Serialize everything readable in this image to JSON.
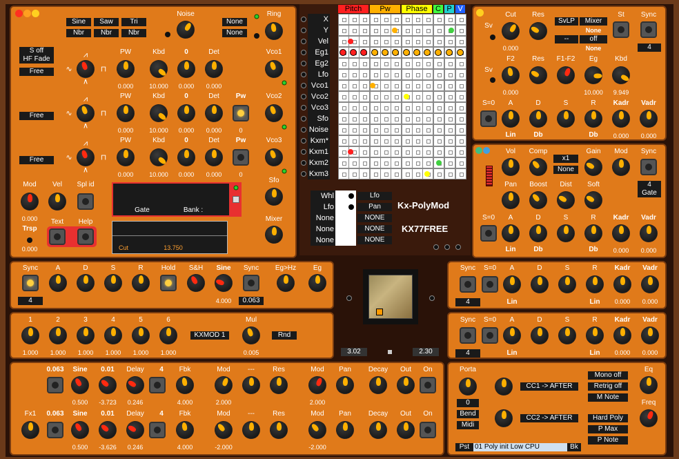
{
  "header": {
    "noise": "Noise",
    "ring": "Ring",
    "wave_buttons": [
      "Sine",
      "Saw",
      "Tri",
      "Nbr",
      "Nbr",
      "Nbr"
    ],
    "ring_modes": [
      "None",
      "None"
    ]
  },
  "osc": {
    "mode_boxes": [
      "S off",
      "HF Fade",
      "Free",
      "Free",
      "Free"
    ],
    "rows": [
      {
        "pw": "PW",
        "kbd": "Kbd",
        "zero": "0",
        "det": "Det",
        "v": [
          "0.000",
          "10.000",
          "0.000",
          "0.000"
        ],
        "label": "Vco1"
      },
      {
        "pw": "PW",
        "kbd": "Kbd",
        "zero": "0",
        "det": "Det",
        "pw2": "Pw",
        "v": [
          "0.000",
          "10.000",
          "0.000",
          "0.000"
        ],
        "extra": "0",
        "label": "Vco2"
      },
      {
        "pw": "PW",
        "kbd": "Kbd",
        "zero": "0",
        "det": "Det",
        "pw2": "Pw",
        "v": [
          "0.000",
          "10.000",
          "0.000",
          "0.000"
        ],
        "extra": "0",
        "label": "Vco3"
      }
    ]
  },
  "misc": {
    "mod": "Mod",
    "vel": "Vel",
    "splid": "Spl id",
    "v": "0.000",
    "trsp": "Trsp",
    "trsp_v": "0.000",
    "text": "Text",
    "help": "Help",
    "sfo": "Sfo",
    "mixer": "Mixer"
  },
  "display": {
    "gate": "Gate",
    "bank": "Bank :",
    "cut": "Cut",
    "cut_value": "13.750"
  },
  "matrix": {
    "headers": [
      "Pitch",
      "Pw",
      "Phase",
      "C",
      "P",
      "V"
    ],
    "header_colors": [
      "#ff2020",
      "#ffb000",
      "#ffff00",
      "#40ff40",
      "#20d0d0",
      "#2060ff"
    ],
    "rows": [
      "X",
      "Y",
      "Vel",
      "Eg1",
      "Eg2",
      "Lfo",
      "Vco1",
      "Vco2",
      "Vco3",
      "Sfo",
      "Noise",
      "Kxm*",
      "Kxm1",
      "Kxm2",
      "Kxm3"
    ],
    "sub": [
      {
        "src": "Whl",
        "dst": "Lfo"
      },
      {
        "src": "Lfo",
        "dst": "Pan"
      },
      {
        "src": "None",
        "dst": "NONE"
      },
      {
        "src": "None",
        "dst": "NONE"
      },
      {
        "src": "None",
        "dst": "NONE"
      }
    ],
    "title": "Kx-PolyMod",
    "subtitle": "KX77FREE"
  },
  "filter": {
    "sv1": "Sv",
    "cut": "Cut",
    "res": "Res",
    "mode": "SvLP",
    "mixer": "Mixer",
    "st": "St",
    "sync": "Sync",
    "cut_v": "0.000",
    "none1": "None",
    "dash": "--",
    "off": "off",
    "none2": "None",
    "sync_v": "4",
    "sv2": "Sv",
    "f2": "F2",
    "res2": "Res",
    "f1f2": "F1-F2",
    "eg": "Eg",
    "kbd": "Kbd",
    "v2": [
      "0.000",
      "10.000",
      "9.949"
    ],
    "adsr": {
      "s0": "S=0",
      "a": "A",
      "d": "D",
      "s": "S",
      "r": "R",
      "kadr": "Kadr",
      "vadr": "Vadr",
      "lin": "Lin",
      "db": "Db",
      "db2": "Db",
      "kv": "0.000",
      "vv": "0.000"
    }
  },
  "amp": {
    "vol": "Vol",
    "comp": "Comp",
    "x1": "x1",
    "none": "None",
    "gain": "Gain",
    "mod": "Mod",
    "sync": "Sync",
    "pan": "Pan",
    "boost": "Boost",
    "dist": "Dist",
    "soft": "Soft",
    "sync_v": "4",
    "gate": "Gate",
    "adsr": {
      "s0": "S=0",
      "a": "A",
      "d": "D",
      "s": "S",
      "r": "R",
      "kadr": "Kadr",
      "vadr": "Vadr",
      "lin": "Lin",
      "db": "Db",
      "db2": "Db",
      "kv": "0.000",
      "vv": "0.000"
    }
  },
  "lfo": {
    "sync": "Sync",
    "a": "A",
    "d": "D",
    "s": "S",
    "r": "R",
    "hold": "Hold",
    "sh": "S&H",
    "sine": "Sine",
    "sync2": "Sync",
    "egHz": "Eg>Hz",
    "eg": "Eg",
    "sync_v": "4",
    "sine_v": "4.000",
    "sync2_v": "0.063"
  },
  "kxmod": {
    "labels": [
      "1",
      "2",
      "3",
      "4",
      "5",
      "6"
    ],
    "values": [
      "1.000",
      "1.000",
      "1.000",
      "1.000",
      "1.000",
      "1.000"
    ],
    "name": "KXMOD 1",
    "mul": "Mul",
    "mul_v": "0.005",
    "rnd": "Rnd"
  },
  "xy": {
    "left": "3.02",
    "right": "2.30"
  },
  "env3": {
    "sync": "Sync",
    "s0": "S=0",
    "a": "A",
    "d": "D",
    "s": "S",
    "r": "R",
    "kadr": "Kadr",
    "vadr": "Vadr",
    "sync_v": "4",
    "lin": "Lin",
    "lin2": "Lin",
    "kv": "0.000",
    "vv": "0.000"
  },
  "env4": {
    "sync": "Sync",
    "s0": "S=0",
    "a": "A",
    "d": "D",
    "s": "S",
    "r": "R",
    "kadr": "Kadr",
    "vadr": "Vadr",
    "sync_v": "4",
    "lin": "Lin",
    "lin2": "Lin",
    "kv": "0.000",
    "vv": "0.000"
  },
  "fx": {
    "row1": {
      "a": "0.063",
      "sine": "Sine",
      "b": "0.01",
      "delay": "Delay",
      "n": "4",
      "fbk": "Fbk",
      "mod": "Mod",
      "dash": "---",
      "res": "Res",
      "mod2": "Mod",
      "pan": "Pan",
      "decay": "Decay",
      "out": "Out",
      "on": "On",
      "v": [
        "0.500",
        "-3.723",
        "0.246",
        "4.000",
        "2.000",
        "2.000"
      ]
    },
    "row2": {
      "fx1": "Fx1",
      "a": "0.063",
      "sine": "Sine",
      "b": "0.01",
      "delay": "Delay",
      "n": "4",
      "fbk": "Fbk",
      "mod": "Mod",
      "dash": "---",
      "res": "Res",
      "mod2": "Mod",
      "pan": "Pan",
      "decay": "Decay",
      "out": "Out",
      "on": "On",
      "v": [
        "0.500",
        "-3.626",
        "0.246",
        "4.000",
        "-2.000",
        "-2.000"
      ]
    }
  },
  "porta": {
    "porta": "Porta",
    "porta_v": "0",
    "bend": "Bend",
    "midi": "Midi",
    "cc1": "CC1 -> AFTER",
    "cc2": "CC2 -> AFTER",
    "mono": "Mono off",
    "retrig": "Retrig off",
    "mnote": "M Note",
    "hard": "Hard Poly",
    "pmax": "P Max",
    "pnote": "P Note",
    "eq": "Eq",
    "freq": "Freq",
    "pst": "Pst",
    "preset": "01 Poly init Low CPU",
    "bk": "Bk"
  }
}
